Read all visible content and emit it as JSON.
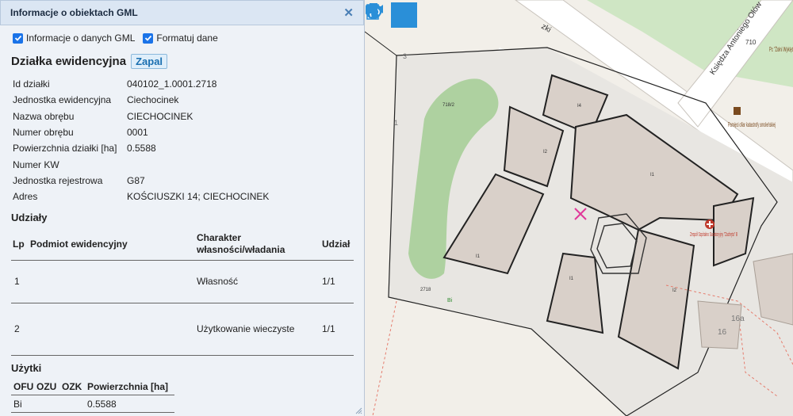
{
  "panel": {
    "title": "Informacje o obiektach GML",
    "close_icon": "close-icon",
    "options": [
      {
        "label": "Informacje o danych GML",
        "checked": true
      },
      {
        "label": "Formatuj dane",
        "checked": true
      }
    ],
    "heading": "Działka ewidencyjna",
    "zapal_label": "Zapal",
    "properties": [
      {
        "key": "Id działki",
        "value": "040102_1.0001.2718"
      },
      {
        "key": "Jednostka ewidencyjna",
        "value": "Ciechocinek"
      },
      {
        "key": "Nazwa obrębu",
        "value": "CIECHOCINEK"
      },
      {
        "key": "Numer obrębu",
        "value": "0001"
      },
      {
        "key": "Powierzchnia działki [ha]",
        "value": "0.5588"
      },
      {
        "key": "Numer KW",
        "value": ""
      },
      {
        "key": "Jednostka rejestrowa",
        "value": "G87"
      },
      {
        "key": "Adres",
        "value": "KOŚCIUSZKI 14; CIECHOCINEK"
      }
    ],
    "udzialy": {
      "title": "Udziały",
      "headers": [
        "Lp",
        "Podmiot ewidencyjny",
        "Charakter własności/władania",
        "Udział"
      ],
      "rows": [
        [
          "1",
          "",
          "Własność",
          "1/1"
        ],
        [
          "2",
          "",
          "Użytkowanie wieczyste",
          "1/1"
        ]
      ]
    },
    "uzytki": {
      "title": "Użytki",
      "headers": [
        "OFU",
        "OZU",
        "OZK",
        "Powierzchnia [ha]"
      ],
      "rows": [
        [
          "Bi",
          "",
          "",
          "0.5588"
        ]
      ]
    }
  },
  "map": {
    "toolbar": [
      {
        "icon": "link-icon",
        "active": false
      },
      {
        "icon": "info-icon",
        "active": true
      },
      {
        "icon": "info-document-icon",
        "active": false
      },
      {
        "icon": "ruler-icon",
        "active": false
      },
      {
        "icon": "printer-icon",
        "active": false
      },
      {
        "icon": "globe-icon",
        "active": false
      },
      {
        "icon": "video-camera-icon",
        "active": false
      }
    ],
    "labels": {
      "street": "Księdza Antoniego Ołów",
      "street_short": "zki",
      "memorial": "Pamięci ofiar katastrofy smoleńskiej",
      "hospital": "Zespół Szpitalno Sanatoryjny \"Zachęta\" B",
      "parcel_718": "718/2",
      "parcel_2718": "2718",
      "num_710": "710",
      "num_3": "3",
      "num_1": "1",
      "num_16": "16",
      "num_16a": "16a",
      "bi": "Bi",
      "i4": "I4",
      "i2": "I2",
      "i1": "I1",
      "poi_right_top": "Pc \"Żołni Wyklęt"
    },
    "colors": {
      "accent": "#2a8fd8",
      "building": "#d9d0c9",
      "green": "#aed1a0",
      "road": "#ffffff",
      "marker": "#e0399a"
    }
  }
}
